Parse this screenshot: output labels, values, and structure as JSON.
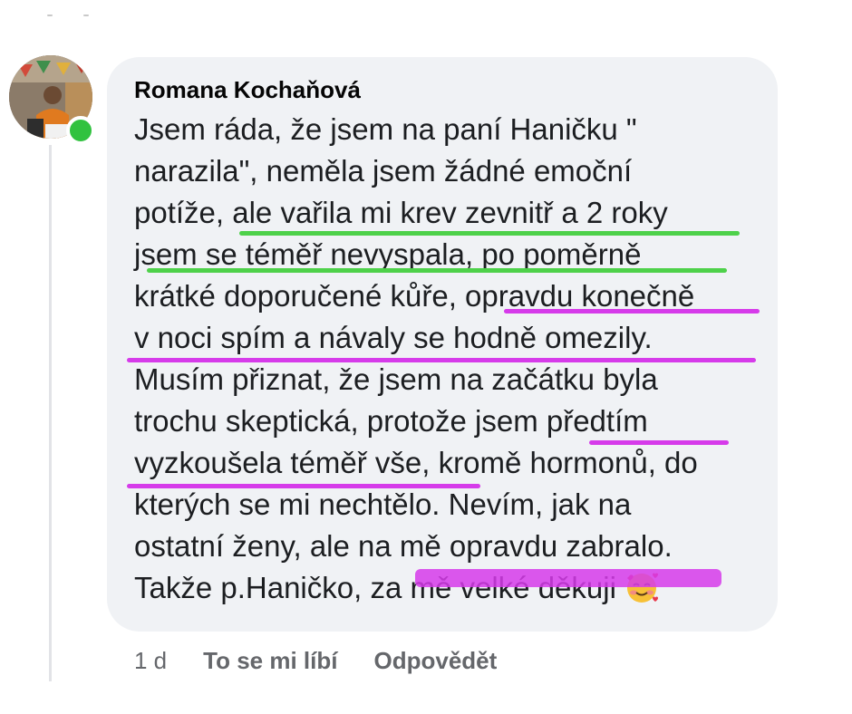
{
  "comment": {
    "author": "Romana Kochaňová",
    "avatar_icon": "profile-photo",
    "online_status_color": "#31c23f",
    "text_lines": [
      "Jsem ráda, že jsem na paní Haničku \"",
      "narazila\", neměla jsem žádné emoční",
      "potíže, ale vařila mi krev zevnitř a 2 roky",
      "jsem se téměř nevyspala, po poměrně",
      "krátké doporučené kůře, opravdu konečně",
      "v noci spím a návaly se hodně omezily.",
      "Musím přiznat, že jsem na začátku byla",
      "trochu skeptická, protože jsem předtím",
      "vyzkoušela téměř vše, kromě hormonů, do",
      "kterých se mi nechtělo. Nevím, jak na",
      "ostatní ženy, ale na mě opravdu zabralo.",
      "Takže p.Haničko, za mě velké děkuji"
    ],
    "emoji_icon": "smiling-face-with-hearts",
    "highlight_colors": {
      "green": "#4ed14a",
      "magenta": "#d63bea"
    }
  },
  "actions": {
    "time": "1 d",
    "like_label": "To se mi líbí",
    "reply_label": "Odpovědět"
  }
}
